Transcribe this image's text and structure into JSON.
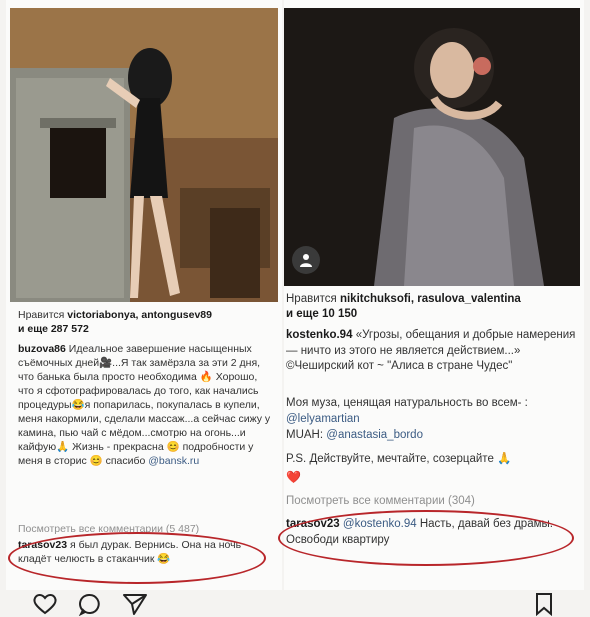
{
  "left_post": {
    "likes_label": "Нравится",
    "likes_users": "victoriabonya, antongusev89",
    "likes_more": "и еще 287 572",
    "caption_user": "buzova86",
    "caption_text": "Идеальное завершение насыщенных съёмочных дней🎥...Я так замёрзла за эти 2 дня, что банька была просто необходима 🔥 Хорошо, что я сфотографировалась до того, как начались процедуры😂я попарилась, покупалась в купели, меня накормили, сделали массаж...а сейчас сижу у камина, пью чай с мёдом...смотрю на огонь...и кайфую🙏 Жизнь - прекрасна 😊 подробности у меня в сторис 😊 спасибо",
    "caption_link": "@bansk.ru",
    "view_all": "Посмотреть все комментарии (5 487)",
    "comment_user": "tarasov23",
    "comment_text": "я был дурак. Вернись. Она на ночь кладёт челюсть в стаканчик 😂"
  },
  "right_post": {
    "likes_label": "Нравится",
    "likes_users": "nikitchuksofi, rasulova_valentina",
    "likes_more": "и еще 10 150",
    "caption_user": "kostenko.94",
    "caption_text": "«Угрозы, обещания и добрые намерения — ничто из этого не является действием...» ©Чеширский кот ~ \"Алиса в стране Чудес\"",
    "line2": "Моя муза, ценящая натуральность во всем- :",
    "line2_link": "@lelyamartian",
    "line3_label": "MUAH:",
    "line3_link": "@anastasia_bordo",
    "line4": "P.S. Действуйте, мечтайте, созерцайте 🙏",
    "line5": "❤️",
    "view_all": "Посмотреть все комментарии (304)",
    "comment_user": "tarasov23",
    "comment_link": "@kostenko.94",
    "comment_text": "Насть, давай без драмы. Освободи квартиру"
  },
  "icons": [
    "heart-icon",
    "comment-icon",
    "share-icon",
    "bookmark-icon",
    "user-tag-icon"
  ],
  "colors": {
    "annotation": "#b8262a",
    "link": "#3b5b83"
  }
}
